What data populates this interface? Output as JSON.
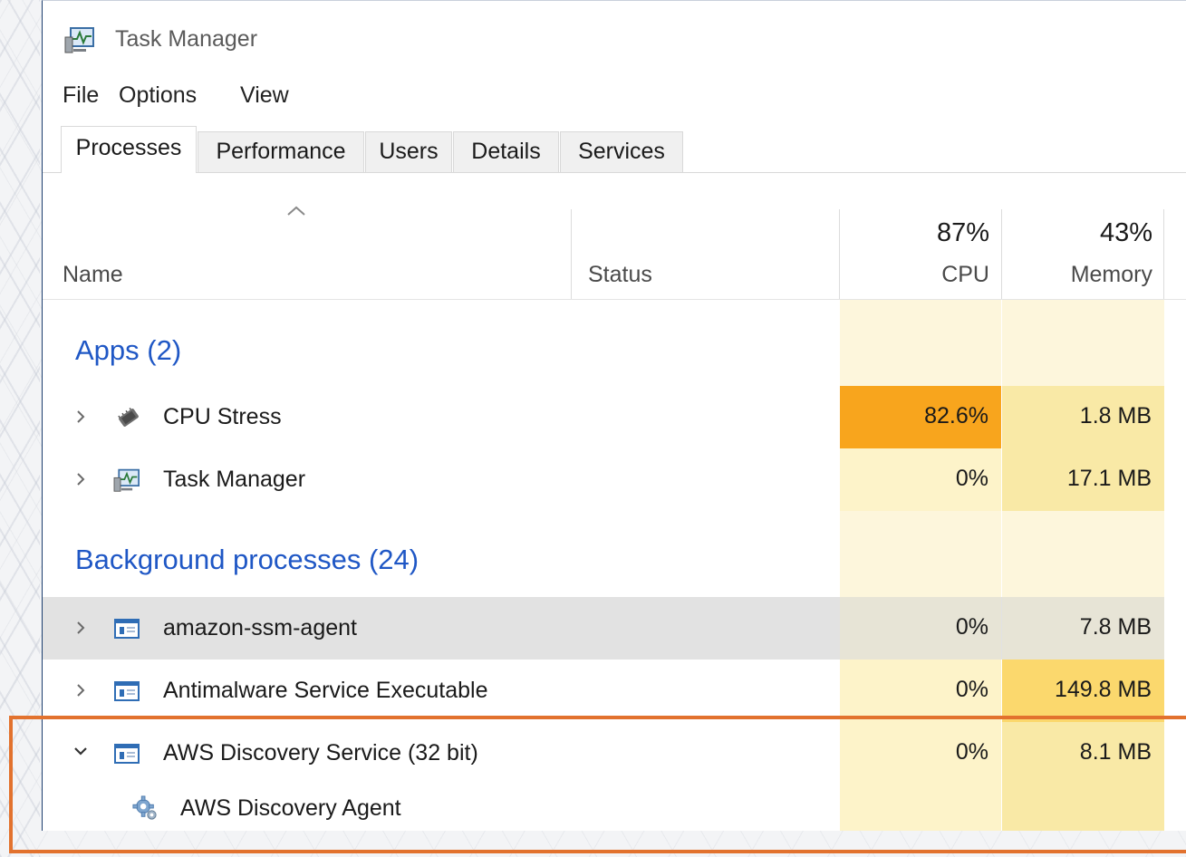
{
  "window": {
    "title": "Task Manager"
  },
  "menu": [
    "File",
    "Options",
    "View"
  ],
  "tabs": [
    "Processes",
    "Performance",
    "Users",
    "Details",
    "Services"
  ],
  "columns": {
    "name": "Name",
    "status": "Status",
    "cpu": {
      "label": "CPU",
      "total": "87%"
    },
    "memory": {
      "label": "Memory",
      "total": "43%"
    }
  },
  "groups": {
    "apps": "Apps (2)",
    "background": "Background processes (24)"
  },
  "processes": [
    {
      "name": "CPU Stress",
      "cpu": "82.6%",
      "memory": "1.8 MB",
      "icon": "chip-icon"
    },
    {
      "name": "Task Manager",
      "cpu": "0%",
      "memory": "17.1 MB",
      "icon": "task-manager-icon"
    },
    {
      "name": "amazon-ssm-agent",
      "cpu": "0%",
      "memory": "7.8 MB",
      "icon": "service-window-icon"
    },
    {
      "name": "Antimalware Service Executable",
      "cpu": "0%",
      "memory": "149.8 MB",
      "icon": "service-window-icon"
    },
    {
      "name": "AWS Discovery Service (32 bit)",
      "cpu": "0%",
      "memory": "8.1 MB",
      "icon": "service-window-icon",
      "expanded": true
    },
    {
      "name": "AWS Discovery Agent",
      "icon": "gear-icon"
    }
  ],
  "colors": {
    "heat_high": "#f8a51d",
    "heat_light": "#fdf3c9",
    "heat_mid": "#f9e9a6",
    "heat_memory_high": "#fbd86d",
    "selected_row": "#e2e2e2",
    "group_text": "#1f57c5",
    "highlight_box": "#e2722e"
  }
}
